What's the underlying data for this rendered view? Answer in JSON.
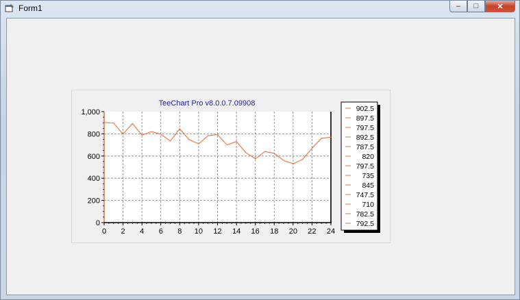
{
  "window": {
    "title": "Form1"
  },
  "chart_data": {
    "type": "line",
    "title": "TeeChart Pro v8.0.0.7.09908",
    "xlabel": "",
    "ylabel": "",
    "xlim": [
      0,
      24
    ],
    "ylim": [
      0,
      1000
    ],
    "x_ticks": [
      0,
      2,
      4,
      6,
      8,
      10,
      12,
      14,
      16,
      18,
      20,
      22,
      24
    ],
    "y_ticks": [
      0,
      200,
      400,
      600,
      800,
      1000
    ],
    "y_tick_labels": [
      "0",
      "200",
      "400",
      "600",
      "800",
      "1,000"
    ],
    "grid": true,
    "legend_position": "right",
    "series_color": "#e8703c",
    "x": [
      0,
      1,
      2,
      3,
      4,
      5,
      6,
      7,
      8,
      9,
      10,
      11,
      12,
      13,
      14,
      15,
      16,
      17,
      18,
      19,
      20,
      21,
      22,
      23,
      24
    ],
    "values": [
      902.5,
      897.5,
      797.5,
      892.5,
      787.5,
      820,
      797.5,
      735,
      845,
      747.5,
      710,
      782.5,
      792.5,
      700,
      730,
      630,
      575,
      640,
      625,
      560,
      530,
      570,
      670,
      760,
      770
    ],
    "legend_items": [
      "902.5",
      "897.5",
      "797.5",
      "892.5",
      "787.5",
      "820",
      "797.5",
      "735",
      "845",
      "747.5",
      "710",
      "782.5",
      "792.5"
    ]
  }
}
